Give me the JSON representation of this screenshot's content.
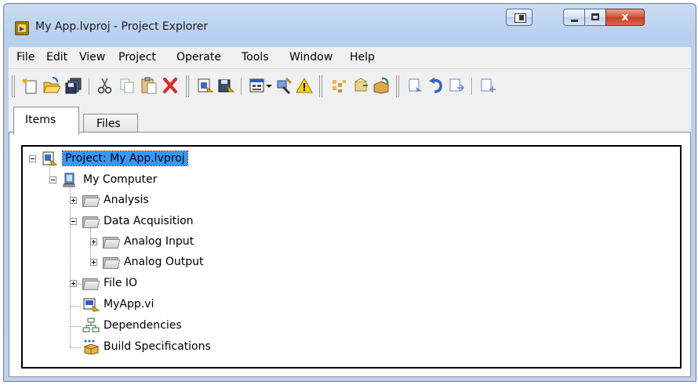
{
  "window": {
    "title": "My App.lvproj - Project Explorer",
    "close_glyph": "x",
    "colors": {
      "title_gradient_top": "#c9dcf2",
      "selection": "#3399ff",
      "close_button": "#c94a33"
    }
  },
  "menubar": {
    "items": [
      "File",
      "Edit",
      "View",
      "Project",
      "Operate",
      "Tools",
      "Window",
      "Help"
    ]
  },
  "toolbar": {
    "buttons": [
      "new-icon",
      "open-icon",
      "save-all-icon",
      "cut-icon",
      "copy-icon",
      "paste-icon",
      "delete-icon",
      "project-icon",
      "save-project-icon",
      "view-layout-icon",
      "dropdown-arrow-icon",
      "tools-icon",
      "warning-icon",
      "build-icon",
      "deploy-icon",
      "package-icon",
      "vi-icon",
      "undo-icon",
      "vi-run-icon",
      "vi-new-icon"
    ]
  },
  "tabs": [
    {
      "label": "Items",
      "selected": true
    },
    {
      "label": "Files",
      "selected": false
    }
  ],
  "tree": {
    "root": "Project: My App.lvproj",
    "computer": "My Computer",
    "items": [
      {
        "label": "Analysis",
        "type": "folder",
        "expanded": false
      },
      {
        "label": "Data Acquisition",
        "type": "folder",
        "expanded": true
      },
      {
        "label": "Analog Input",
        "type": "folder",
        "expanded": false
      },
      {
        "label": "Analog Output",
        "type": "folder",
        "expanded": false
      },
      {
        "label": "File IO",
        "type": "folder",
        "expanded": false
      },
      {
        "label": "MyApp.vi",
        "type": "vi"
      },
      {
        "label": "Dependencies",
        "type": "dependencies"
      },
      {
        "label": "Build Specifications",
        "type": "build"
      }
    ]
  }
}
